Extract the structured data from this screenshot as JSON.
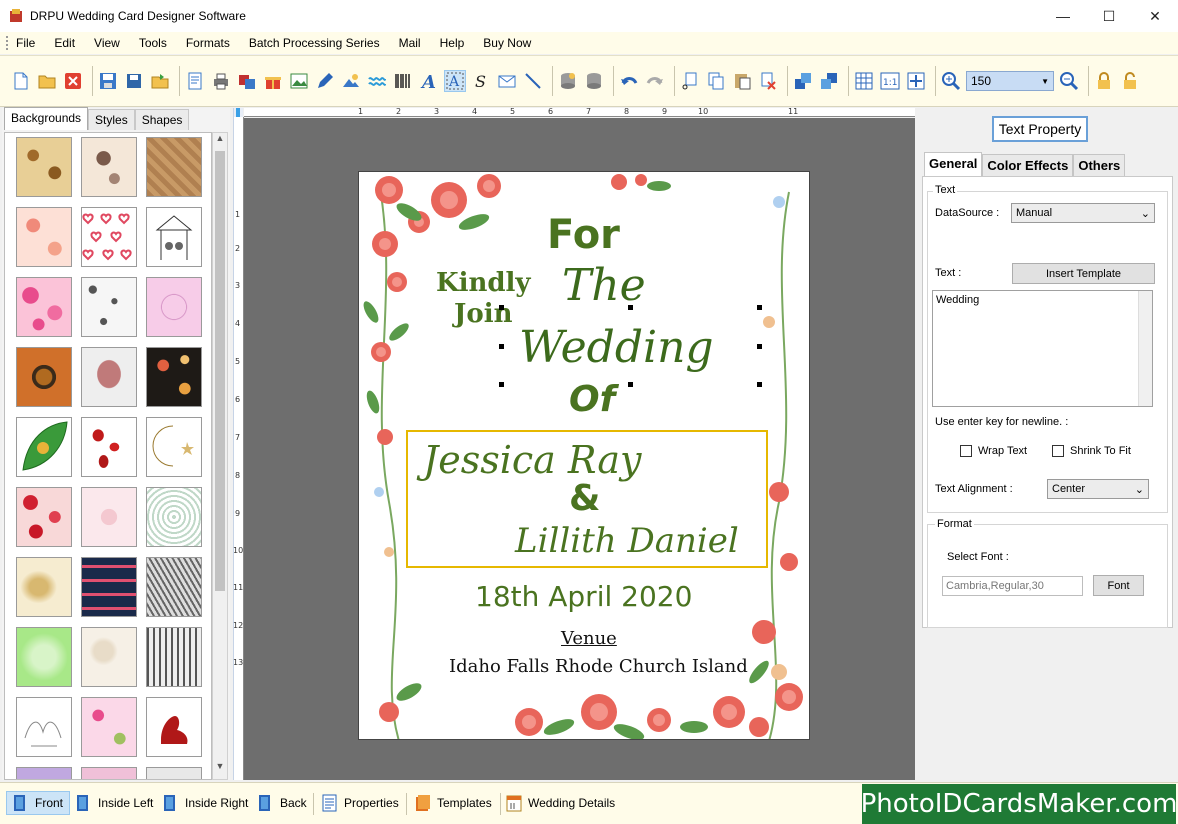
{
  "window": {
    "title": "DRPU Wedding Card Designer Software"
  },
  "menu": [
    "File",
    "Edit",
    "View",
    "Tools",
    "Formats",
    "Batch Processing Series",
    "Mail",
    "Help",
    "Buy Now"
  ],
  "toolbar": {
    "zoom_value": "150"
  },
  "left_panel": {
    "tabs": [
      "Backgrounds",
      "Styles",
      "Shapes"
    ],
    "active_tab": "Backgrounds"
  },
  "ruler": {
    "h_labels": [
      "1",
      "2",
      "3",
      "4",
      "5",
      "6",
      "7",
      "8",
      "9",
      "10",
      "11"
    ],
    "v_labels": [
      "1",
      "2",
      "3",
      "4",
      "5",
      "6",
      "7",
      "8",
      "9",
      "10",
      "11",
      "12",
      "13"
    ]
  },
  "card": {
    "for": "For",
    "kindly": "Kindly",
    "join": "Join",
    "the": "The",
    "wedding": "Wedding",
    "of": "Of",
    "groom": "Jessica Ray",
    "amp": "&",
    "bride": "Lillith Daniel",
    "date": "18th April 2020",
    "venue_label": "Venue",
    "venue": "Idaho Falls Rhode Church Island",
    "accent_color": "#4a7320"
  },
  "text_property": {
    "title": "Text Property",
    "tabs": [
      "General",
      "Color Effects",
      "Others"
    ],
    "text_group": "Text",
    "datasource_label": "DataSource :",
    "datasource_value": "Manual",
    "text_label": "Text :",
    "insert_template": "Insert Template",
    "text_value": "Wedding",
    "newline_hint": "Use enter key for newline. :",
    "wrap_text": "Wrap Text",
    "shrink_to_fit": "Shrink To Fit",
    "alignment_label": "Text Alignment :",
    "alignment_value": "Center",
    "format_group": "Format",
    "select_font": "Select Font :",
    "font_value": "Cambria,Regular,30",
    "font_button": "Font"
  },
  "bottom": {
    "buttons": [
      "Front",
      "Inside Left",
      "Inside Right",
      "Back",
      "Properties",
      "Templates",
      "Wedding Details"
    ],
    "watermark": "PhotoIDCardsMaker.com"
  }
}
